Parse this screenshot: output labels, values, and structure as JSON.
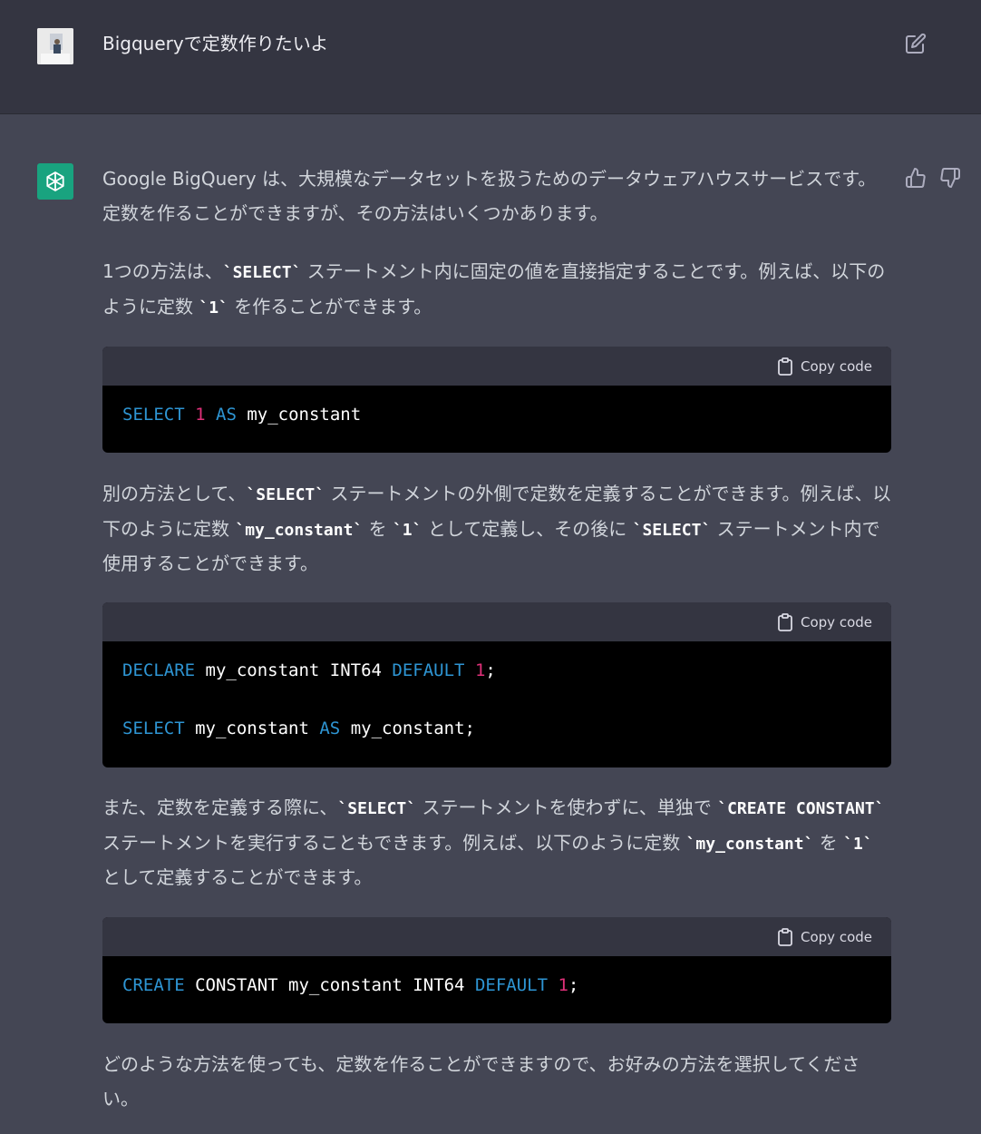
{
  "user_message": {
    "text": "Bigqueryで定数作りたいよ"
  },
  "assistant": {
    "paragraphs": [
      [
        "Google BigQuery は、大規模なデータセットを扱うためのデータウェアハウスサービスです。定数を作ることができますが、その方法はいくつかあります。"
      ],
      [
        "1つの方法は、",
        "`SELECT`",
        " ステートメント内に固定の値を直接指定することです。例えば、以下のように定数 ",
        "`1`",
        " を作ることができます。"
      ],
      [
        "別の方法として、",
        "`SELECT`",
        " ステートメントの外側で定数を定義することができます。例えば、以下のように定数 ",
        "`my_constant`",
        " を ",
        "`1`",
        " として定義し、その後に ",
        "`SELECT`",
        " ステートメント内で使用することができます。"
      ],
      [
        "また、定数を定義する際に、",
        "`SELECT`",
        " ステートメントを使わずに、単独で ",
        "`CREATE CONSTANT`",
        " ステートメントを実行することもできます。例えば、以下のように定数 ",
        "`my_constant`",
        " を ",
        "`1`",
        " として定義することができます。"
      ],
      [
        "どのような方法を使っても、定数を作ることができますので、お好みの方法を選択してください。"
      ]
    ],
    "copy_label": "Copy code",
    "code_blocks": [
      [
        [
          [
            "SELECT",
            "kw"
          ],
          [
            " ",
            ""
          ],
          [
            "1",
            "num"
          ],
          [
            " ",
            ""
          ],
          [
            "AS",
            "kw"
          ],
          [
            " my_constant",
            ""
          ]
        ]
      ],
      [
        [
          [
            "DECLARE",
            "kw"
          ],
          [
            " my_constant INT64 ",
            ""
          ],
          [
            "DEFAULT",
            "kw"
          ],
          [
            " ",
            ""
          ],
          [
            "1",
            "num"
          ],
          [
            ";",
            ""
          ]
        ],
        [
          [
            "SELECT",
            "kw"
          ],
          [
            " my_constant ",
            ""
          ],
          [
            "AS",
            "kw"
          ],
          [
            " my_constant;",
            ""
          ]
        ]
      ],
      [
        [
          [
            "CREATE",
            "kw"
          ],
          [
            " CONSTANT my_constant INT64 ",
            ""
          ],
          [
            "DEFAULT",
            "kw"
          ],
          [
            " ",
            ""
          ],
          [
            "1",
            "num"
          ],
          [
            ";",
            ""
          ]
        ]
      ]
    ]
  },
  "colors": {
    "keyword": "#2e95d3",
    "number": "#df3079",
    "gpt_green": "#19a37f"
  },
  "icons": [
    "edit-icon",
    "openai-logo-icon",
    "thumbs-up-icon",
    "thumbs-down-icon",
    "clipboard-icon"
  ]
}
